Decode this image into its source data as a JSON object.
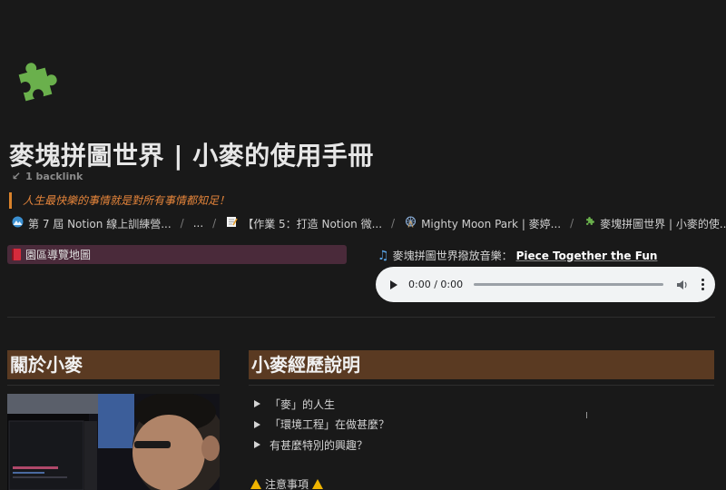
{
  "page": {
    "title": "麥塊拼圖世界 | 小麥的使用手冊",
    "backlink": "1 backlink",
    "quote": "人生最快樂的事情就是對所有事情都知足！",
    "icon": "puzzle-piece-icon",
    "accent_color": "#e4843a"
  },
  "breadcrumb": [
    {
      "icon": "mountain-icon",
      "label": "第 7 屆 Notion 線上訓練營..."
    },
    {
      "icon": "",
      "label": "..."
    },
    {
      "icon": "memo-icon",
      "label": "【作業 5：打造 Notion 微..."
    },
    {
      "icon": "ferris-wheel-icon",
      "label": "Mighty Moon Park | 麥婷..."
    },
    {
      "icon": "puzzle-piece-icon",
      "label": "麥塊拼圖世界 | 小麥的使..."
    }
  ],
  "map_link": {
    "label": "園區導覽地圖",
    "icon": "red-book-icon"
  },
  "music": {
    "prefix": "麥塊拼圖世界撥放音樂：",
    "link": "Piece Together the Fun",
    "icon": "music-note-icon"
  },
  "audio": {
    "time": "0:00 / 0:00",
    "progress": 0
  },
  "left_heading": "關於小麥",
  "right_heading": "小麥經歷說明",
  "toggles": [
    "「麥」的人生",
    "「環境工程」在做甚麼？",
    "有甚麼特別的興趣？"
  ],
  "notice": "注意事項"
}
